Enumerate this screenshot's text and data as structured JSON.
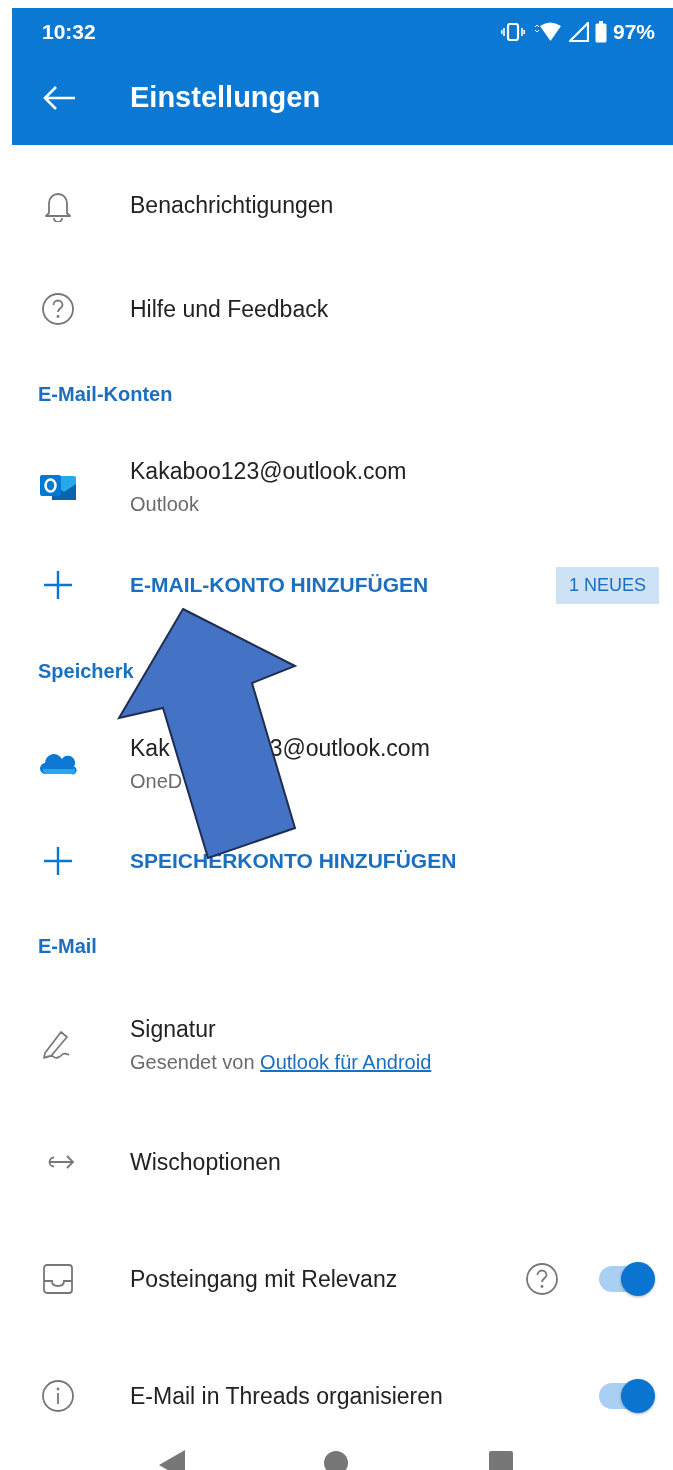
{
  "status_bar": {
    "time": "10:32",
    "battery": "97%"
  },
  "toolbar": {
    "title": "Einstellungen"
  },
  "general": [
    {
      "label": "Benachrichtigungen"
    },
    {
      "label": "Hilfe und Feedback"
    }
  ],
  "mail_accounts": {
    "heading": "E-Mail-Konten",
    "account": {
      "title": "Kakaboo123@outlook.com",
      "subtitle": "Outlook"
    },
    "add": {
      "label": "E-MAIL-KONTO HINZUFÜGEN",
      "badge": "1 NEUES"
    }
  },
  "storage_accounts": {
    "heading": "Speicherk",
    "account": {
      "title_start": "Kak",
      "title_end": "3@outlook.com",
      "subtitle": "OneD"
    },
    "add": {
      "label": "SPEICHERKONTO HINZUFÜGEN"
    }
  },
  "mail": {
    "heading": "E-Mail",
    "signature": {
      "label": "Signatur",
      "subtitle": "Gesendet von",
      "link": "Outlook für Android"
    },
    "swipe": {
      "label": "Wischoptionen"
    },
    "focused_inbox": {
      "label": "Posteingang mit Relevanz",
      "on": true
    },
    "threads": {
      "label": "E-Mail in Threads organisieren",
      "on": true
    }
  }
}
